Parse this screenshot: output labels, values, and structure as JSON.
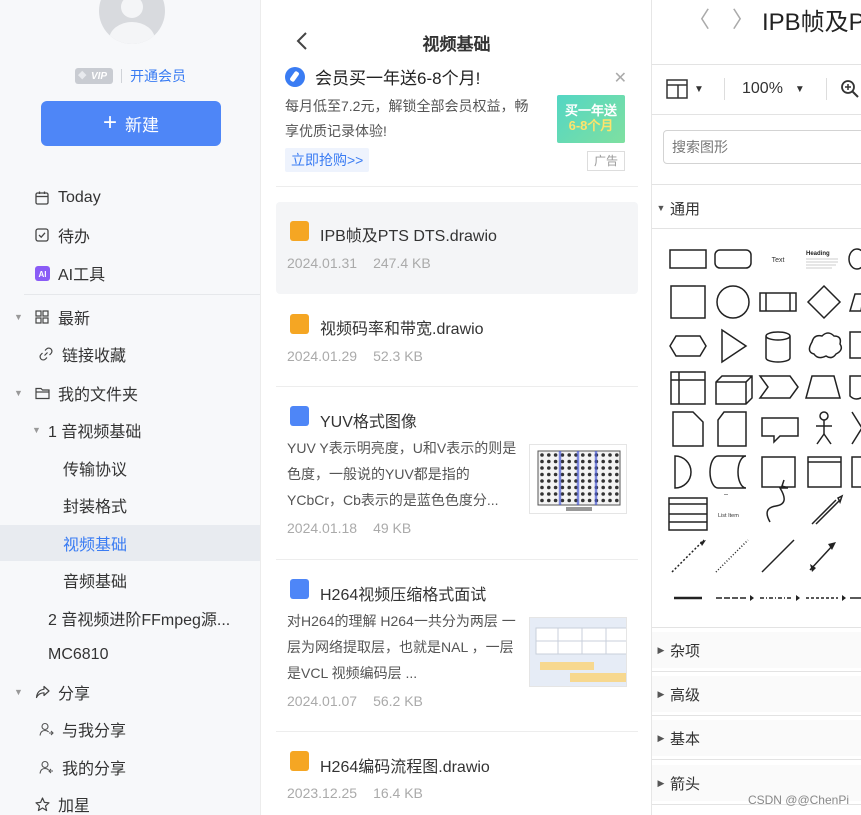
{
  "sidebar": {
    "vip_badge": "VIP",
    "vip_link": "开通会员",
    "new_button": "新建",
    "items": [
      {
        "label": "Today",
        "icon": "calendar-icon"
      },
      {
        "label": "待办",
        "icon": "checkbox-icon"
      },
      {
        "label": "AI工具",
        "icon": "ai-icon"
      },
      {
        "label": "最新",
        "icon": "grid-icon"
      },
      {
        "label": "链接收藏",
        "icon": "link-icon"
      },
      {
        "label": "我的文件夹",
        "icon": "folder-icon"
      },
      {
        "label": "1 音视频基础"
      },
      {
        "label": "传输协议"
      },
      {
        "label": "封装格式"
      },
      {
        "label": "视频基础"
      },
      {
        "label": "音频基础"
      },
      {
        "label": "2 音视频进阶FFmpeg源..."
      },
      {
        "label": "MC6810"
      },
      {
        "label": "分享",
        "icon": "share-icon"
      },
      {
        "label": "与我分享",
        "icon": "user-share-icon"
      },
      {
        "label": "我的分享",
        "icon": "my-share-icon"
      },
      {
        "label": "加星",
        "icon": "star-icon"
      }
    ]
  },
  "list": {
    "title": "视频基础",
    "promo": {
      "headline": "会员买一年送6-8个月!",
      "text": "每月低至7.2元，解锁全部会员权益，畅享优质记录体验!",
      "link": "立即抢购>>",
      "image_line1": "买一年送",
      "image_line2": "6-8个月",
      "ad_label": "广告"
    },
    "files": [
      {
        "name": "IPB帧及PTS DTS.drawio",
        "date": "2024.01.31",
        "size": "247.4 KB",
        "type": "drawio"
      },
      {
        "name": "视频码率和带宽.drawio",
        "date": "2024.01.29",
        "size": "52.3 KB",
        "type": "drawio"
      },
      {
        "name": "YUV格式图像",
        "date": "2024.01.18",
        "size": "49 KB",
        "type": "doc",
        "snippet": "YUV Y表示明亮度，U和V表示的则是色度，一般说的YUV都是指的YCbCr，Cb表示的是蓝色色度分..."
      },
      {
        "name": "H264视频压缩格式面试",
        "date": "2024.01.07",
        "size": "56.2 KB",
        "type": "doc",
        "snippet": "对H264的理解 H264一共分为两层 一层为网络提取层，也就是NAL ，一层是VCL 视频编码层 ..."
      },
      {
        "name": "H264编码流程图.drawio",
        "date": "2023.12.25",
        "size": "16.4 KB",
        "type": "drawio"
      }
    ]
  },
  "editor": {
    "title": "IPB帧及PTS",
    "zoom": "100%",
    "search_placeholder": "搜索图形",
    "sections": [
      "通用",
      "杂项",
      "高级",
      "基本",
      "箭头"
    ],
    "shape_text_label": "Text",
    "shape_heading_label": "Heading",
    "shape_list_label": "List Item"
  },
  "watermark": "CSDN @@ChenPi"
}
